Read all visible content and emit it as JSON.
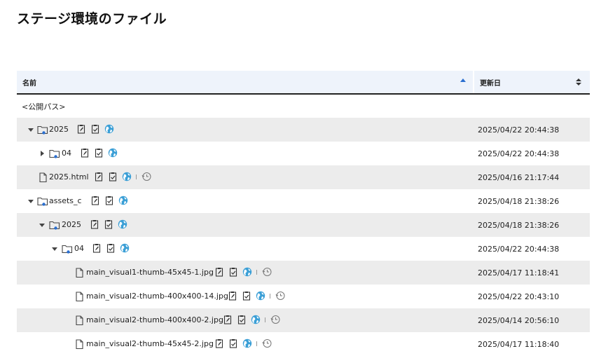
{
  "page": {
    "title": "ステージ環境のファイル"
  },
  "table": {
    "columns": {
      "name": "名前",
      "updated": "更新日"
    },
    "public_path_label": "<公開パス>",
    "rows": [
      {
        "name": "2025",
        "type": "folder",
        "expanded": true,
        "updated": "2025/04/22 20:44:38"
      },
      {
        "name": "04",
        "type": "folder",
        "expanded": false,
        "updated": "2025/04/22 20:44:38"
      },
      {
        "name": "2025.html",
        "type": "file",
        "updated": "2025/04/16 21:17:44"
      },
      {
        "name": "assets_c",
        "type": "folder",
        "expanded": true,
        "updated": "2025/04/18 21:38:26"
      },
      {
        "name": "2025",
        "type": "folder",
        "expanded": true,
        "updated": "2025/04/18 21:38:26"
      },
      {
        "name": "04",
        "type": "folder",
        "expanded": true,
        "updated": "2025/04/22 20:44:38"
      },
      {
        "name": "main_visual1-thumb-45x45-1.jpg",
        "type": "file",
        "updated": "2025/04/17 11:18:41"
      },
      {
        "name": "main_visual2-thumb-400x400-14.jpg",
        "type": "file",
        "updated": "2025/04/22 20:43:10"
      },
      {
        "name": "main_visual2-thumb-400x400-2.jpg",
        "type": "file",
        "updated": "2025/04/14 20:56:10"
      },
      {
        "name": "main_visual2-thumb-45x45-2.jpg",
        "type": "file",
        "updated": "2025/04/17 11:18:40"
      }
    ]
  },
  "colors": {
    "accent": "#2a6fd0",
    "globe": "#3b9fd6",
    "shade": "#ececec",
    "header_bg": "#eef3fb"
  },
  "icons": {
    "folder": "folder-icon",
    "file": "file-icon",
    "edit": "edit-icon",
    "approve": "clipboard-check-icon",
    "publish": "globe-icon",
    "history": "history-icon"
  }
}
